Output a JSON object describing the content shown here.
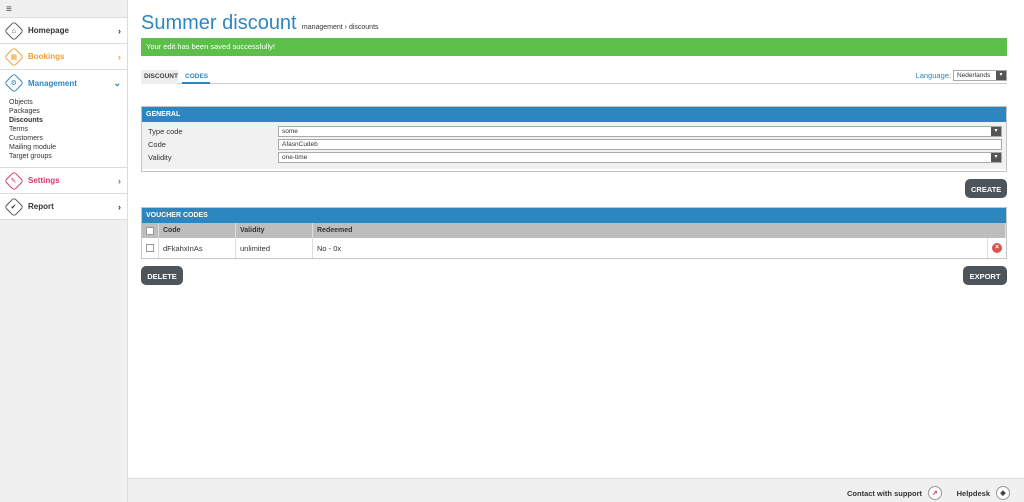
{
  "sidebar": {
    "toggle_icon": "≡",
    "sections": [
      {
        "label": "Homepage",
        "color": "#333333",
        "icon": "⌂"
      },
      {
        "label": "Bookings",
        "color": "#f0a030",
        "icon": "▦"
      },
      {
        "label": "Management",
        "color": "#2e86c1",
        "icon": "⚙"
      },
      {
        "label": "Settings",
        "color": "#d63a6a",
        "icon": "✎"
      },
      {
        "label": "Report",
        "color": "#333333",
        "icon": "✔"
      }
    ],
    "management_items": [
      "Objects",
      "Packages",
      "Discounts",
      "Terms",
      "Customers",
      "Mailing module",
      "Target groups"
    ]
  },
  "header": {
    "title": "Summer discount",
    "breadcrumb": "management › discounts"
  },
  "alert": "Your edit has been saved successfully!",
  "tabs": [
    "DISCOUNT",
    "CODES"
  ],
  "language": {
    "label": "Language:",
    "value": "Nederlands"
  },
  "general": {
    "title": "GENERAL",
    "fields": [
      {
        "label": "Type code",
        "value": "some"
      },
      {
        "label": "Code",
        "value": "AfasnCudeb"
      },
      {
        "label": "Validity",
        "value": "one-time"
      }
    ]
  },
  "buttons": {
    "create": "CREATE",
    "delete": "DELETE",
    "export": "EXPORT"
  },
  "voucher": {
    "title": "VOUCHER CODES",
    "columns": [
      "Code",
      "Validity",
      "Redeemed"
    ],
    "rows": [
      {
        "code": "dFkahxInAs",
        "validity": "unlimited",
        "redeemed": "No - 0x"
      }
    ]
  },
  "footer": {
    "support": "Contact with support",
    "helpdesk": "Helpdesk"
  },
  "colors": {
    "accent": "#2e86c1",
    "success": "#5cbf4a",
    "button": "#4d555b"
  }
}
